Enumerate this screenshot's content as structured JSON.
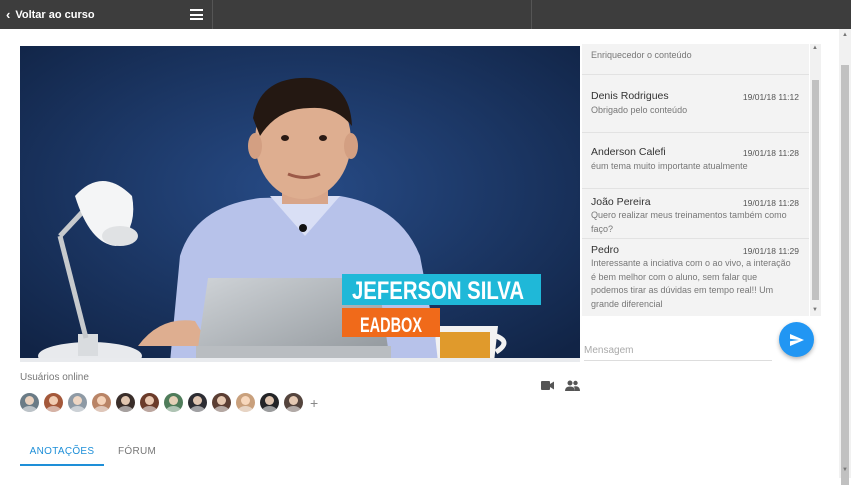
{
  "header": {
    "back_label": "Voltar ao curso"
  },
  "video": {
    "presenter_name": "JEFERSON SILVA",
    "presenter_company": "EADBOX"
  },
  "online": {
    "label": "Usuários online",
    "more": "+"
  },
  "tabs": [
    {
      "label": "ANOTAÇÕES",
      "active": true
    },
    {
      "label": "FÓRUM",
      "active": false
    }
  ],
  "chat": {
    "messages": [
      {
        "name": "",
        "time": "",
        "text": "Enriquecedor o conteúdo"
      },
      {
        "name": "Denis Rodrigues",
        "time": "19/01/18 11:12",
        "text": "Obrigado pelo conteúdo"
      },
      {
        "name": "Anderson Calefi",
        "time": "19/01/18 11:28",
        "text": "éum tema muito importante atualmente"
      },
      {
        "name": "João Pereira",
        "time": "19/01/18 11:28",
        "text": "Quero realizar meus treinamentos também como faço?"
      },
      {
        "name": "Pedro",
        "time": "19/01/18 11:29",
        "text": "Interessante a inciativa com o ao vivo, a interação é bem melhor com o aluno, sem falar que podemos tirar as dúvidas em tempo real!! Um grande diferencial"
      }
    ],
    "input_placeholder": "Mensagem",
    "input_value": ""
  },
  "colors": {
    "accent": "#2196f3",
    "topbar": "#3d3d3d",
    "name_banner": "#1fb8d8",
    "company_banner": "#f06a1a"
  },
  "icons": {
    "back": "chevron-left-icon",
    "menu": "hamburger-menu-icon",
    "camera": "video-camera-icon",
    "people": "people-icon",
    "send": "send-icon"
  }
}
